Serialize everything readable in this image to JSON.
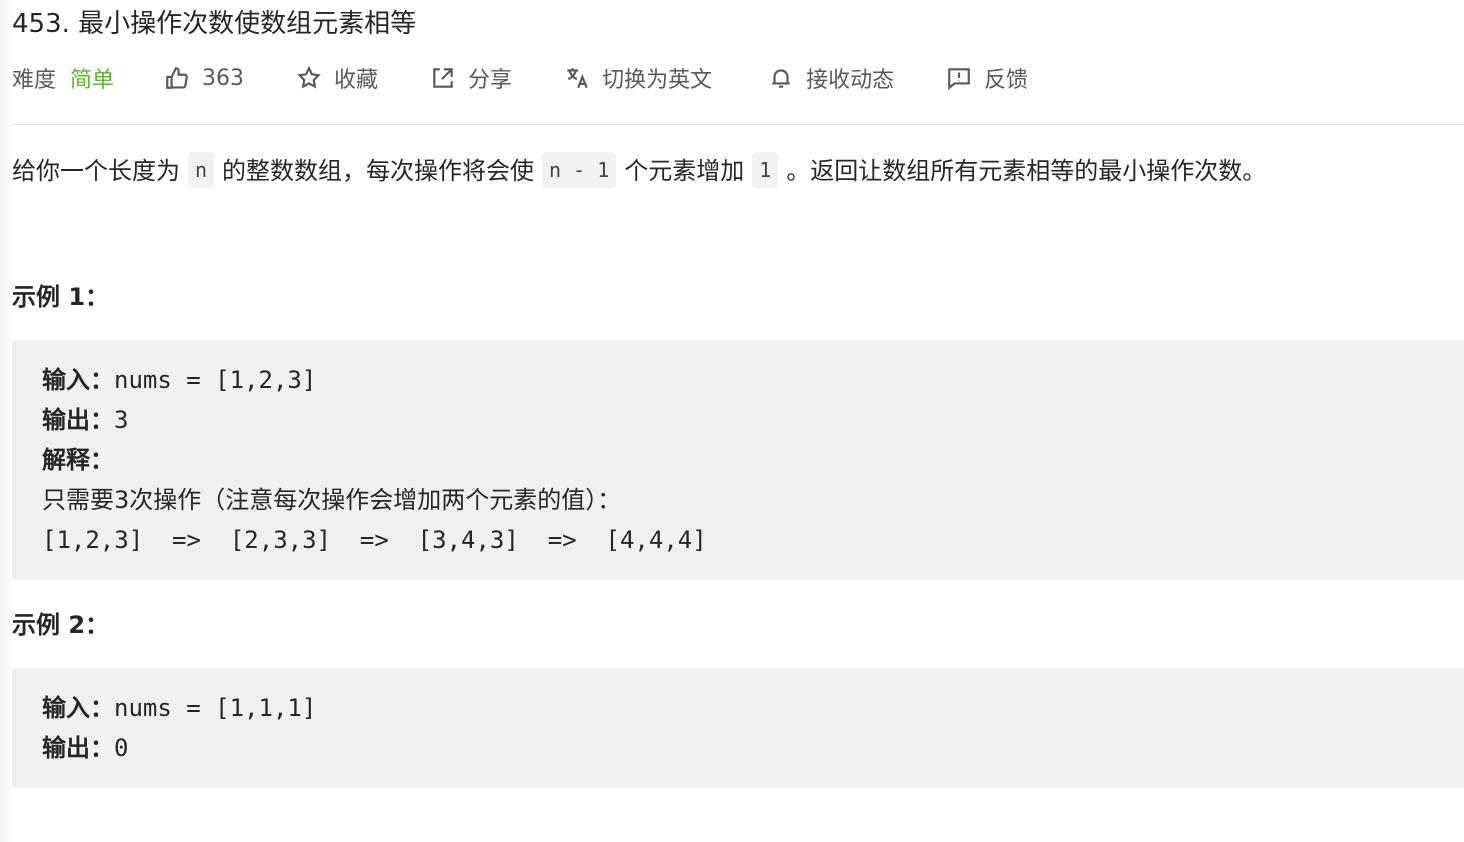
{
  "problem": {
    "title": "453. 最小操作次数使数组元素相等",
    "difficulty_label": "难度",
    "difficulty_value": "简单",
    "difficulty_color": "#5ab726",
    "likes": "363",
    "favorite_label": "收藏",
    "share_label": "分享",
    "translate_label": "切换为英文",
    "subscribe_label": "接收动态",
    "feedback_label": "反馈"
  },
  "description": {
    "part1": "给你一个长度为",
    "code1": "n",
    "part2": "的整数数组，每次操作将会使",
    "code2": "n - 1",
    "part3": "个元素增加",
    "code3": "1",
    "part4": "。返回让数组所有元素相等的最小操作次数。"
  },
  "examples": [
    {
      "heading": "示例 1：",
      "input_label": "输入：",
      "input_value": "nums = [1,2,3]",
      "output_label": "输出：",
      "output_value": "3",
      "explain_label": "解释：",
      "explain_text": "只需要3次操作（注意每次操作会增加两个元素的值）：",
      "explain_steps": "[1,2,3]  =>  [2,3,3]  =>  [3,4,3]  =>  [4,4,4]"
    },
    {
      "heading": "示例 2：",
      "input_label": "输入：",
      "input_value": "nums = [1,1,1]",
      "output_label": "输出：",
      "output_value": "0"
    }
  ],
  "icons": [
    "thumbs-up-icon",
    "star-icon",
    "share-icon",
    "translate-icon",
    "bell-icon",
    "feedback-icon"
  ]
}
